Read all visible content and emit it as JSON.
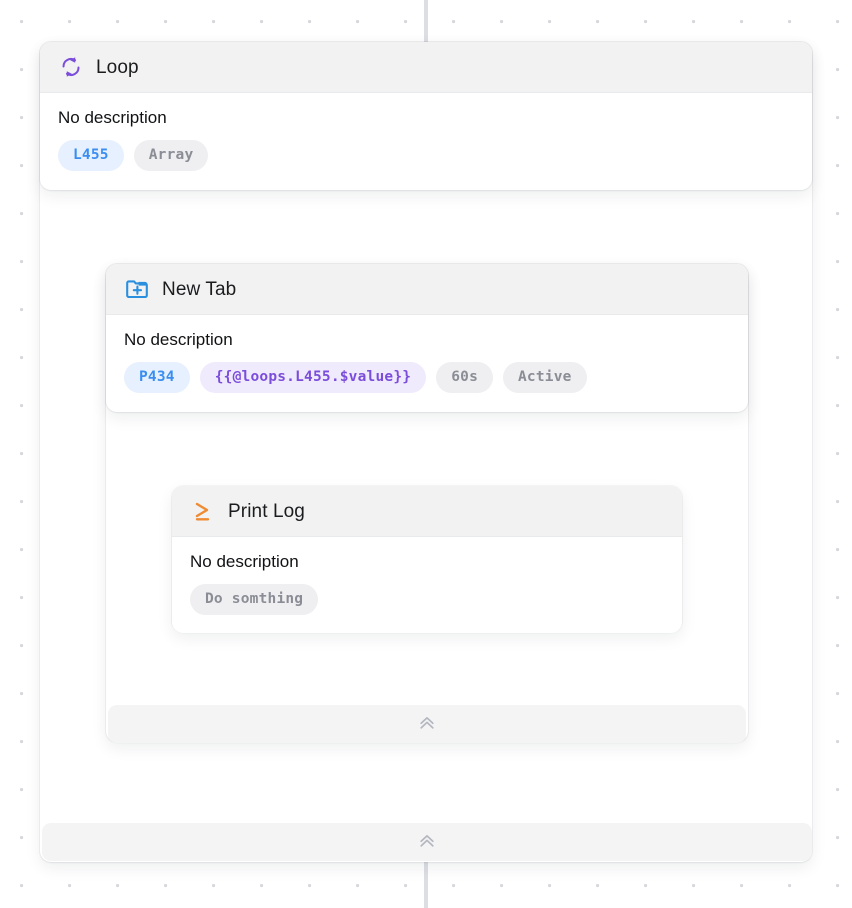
{
  "canvas": {
    "background_color": "#ffffff",
    "dot_color": "#d6d8de",
    "grid_spacing_px": 48,
    "connector_color": "#dcdee3"
  },
  "nodes": [
    {
      "id": "loop",
      "title": "Loop",
      "icon": "loop-refresh-icon",
      "icon_color": "#7b4ddb",
      "description": "No description",
      "badges": [
        {
          "label": "L455",
          "style": "blue"
        },
        {
          "label": "Array",
          "style": "grey"
        }
      ],
      "collapse_label": "«"
    },
    {
      "id": "new-tab",
      "title": "New Tab",
      "icon": "new-tab-icon",
      "icon_color": "#2b8fe0",
      "description": "No description",
      "badges": [
        {
          "label": "P434",
          "style": "blue"
        },
        {
          "label": "{{@loops.L455.$value}}",
          "style": "purple"
        },
        {
          "label": "60s",
          "style": "grey"
        },
        {
          "label": "Active",
          "style": "grey"
        }
      ],
      "collapse_label": "«"
    },
    {
      "id": "print-log",
      "title": "Print Log",
      "icon": "terminal-prompt-icon",
      "icon_color": "#ef8b32",
      "description": "No description",
      "badges": [
        {
          "label": "Do somthing",
          "style": "grey"
        }
      ]
    }
  ]
}
